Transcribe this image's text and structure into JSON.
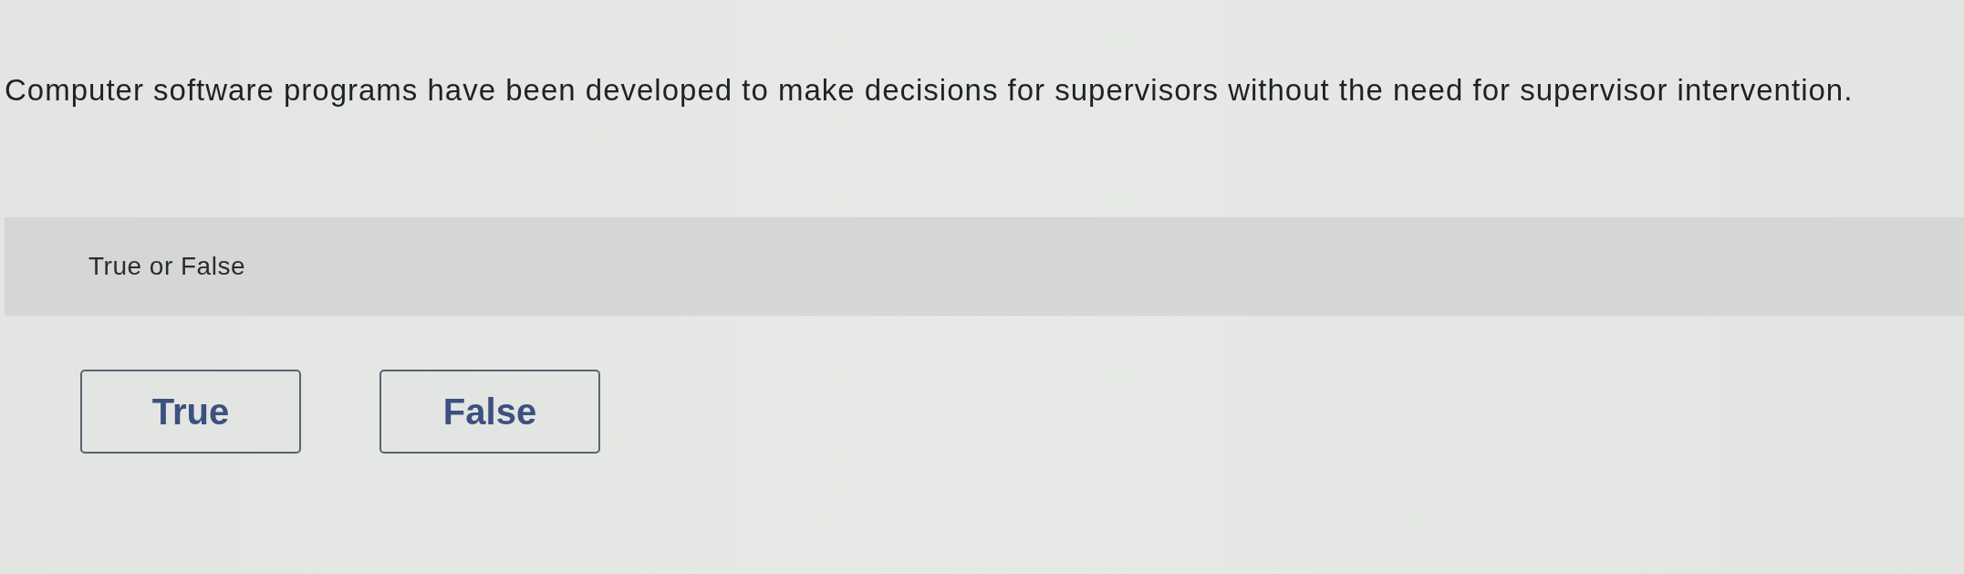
{
  "question": {
    "text": "Computer software programs have been developed to make decisions for supervisors without the need for supervisor intervention."
  },
  "prompt": {
    "text": "True or False"
  },
  "options": [
    {
      "label": "True",
      "selected": false
    },
    {
      "label": "False",
      "selected": false
    }
  ]
}
